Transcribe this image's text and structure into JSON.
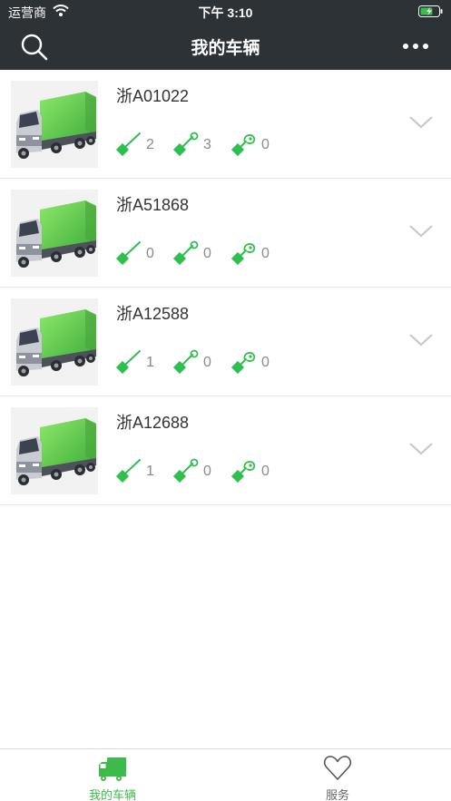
{
  "status_bar": {
    "carrier": "运营商",
    "time": "下午 3:10"
  },
  "header": {
    "title": "我的车辆"
  },
  "colors": {
    "header_bg": "#2d3237",
    "accent": "#3cba4a",
    "stat_icon": "#2fbf4f"
  },
  "vehicles": [
    {
      "plate": "浙A01022",
      "stats": {
        "lead_seal": 2,
        "tag_seal": 3,
        "lock_seal": 0
      }
    },
    {
      "plate": "浙A51868",
      "stats": {
        "lead_seal": 0,
        "tag_seal": 0,
        "lock_seal": 0
      }
    },
    {
      "plate": "浙A12588",
      "stats": {
        "lead_seal": 1,
        "tag_seal": 0,
        "lock_seal": 0
      }
    },
    {
      "plate": "浙A12688",
      "stats": {
        "lead_seal": 1,
        "tag_seal": 0,
        "lock_seal": 0
      }
    }
  ],
  "tabs": [
    {
      "label": "我的车辆",
      "icon": "truck-icon",
      "active": true
    },
    {
      "label": "服务",
      "icon": "heart-icon",
      "active": false
    }
  ]
}
